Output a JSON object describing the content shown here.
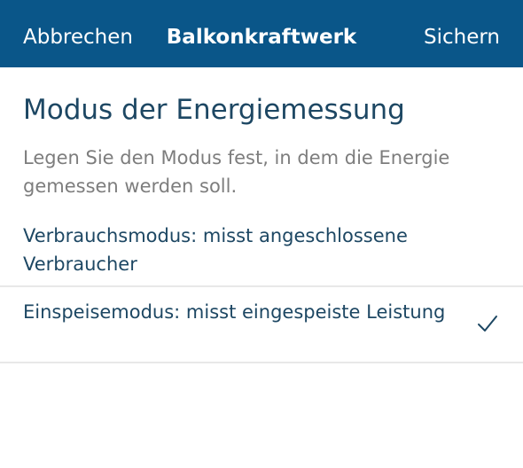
{
  "header": {
    "cancel_label": "Abbrechen",
    "title": "Balkonkraftwerk",
    "save_label": "Sichern",
    "background_color": "#0a5689"
  },
  "section": {
    "title": "Modus der Energiemessung",
    "description": "Legen Sie den Modus fest, in dem die Energie gemessen werden soll."
  },
  "options": [
    {
      "label": "Verbrauchsmodus: misst angeschlossene Verbraucher",
      "selected": false
    },
    {
      "label": "Einspeisemodus: misst eingespeiste Leistung",
      "selected": true,
      "icon": "checkmark-icon"
    }
  ]
}
